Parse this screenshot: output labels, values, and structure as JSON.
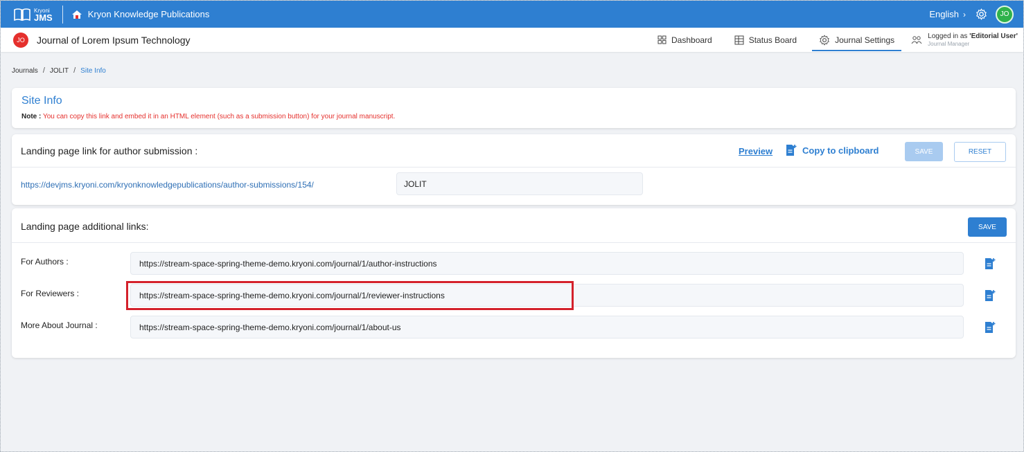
{
  "topbar": {
    "logo_small": "Kryoni",
    "logo_big": "JMS",
    "org_name": "Kryon Knowledge Publications",
    "language": "English",
    "user_initials": "JO",
    "colors": {
      "bar": "#2e7fd1",
      "user_badge": "#2fb24b"
    }
  },
  "subheader": {
    "journal_initials": "JO",
    "journal_title": "Journal of Lorem Ipsum Technology",
    "nav": {
      "dashboard": "Dashboard",
      "status_board": "Status Board",
      "journal_settings": "Journal Settings"
    },
    "logged_prefix": "Logged in as ",
    "logged_user": "'Editorial User'",
    "logged_role": "Journal Manager"
  },
  "breadcrumb": {
    "items": [
      "Journals",
      "JOLIT",
      "Site Info"
    ],
    "separator": "/"
  },
  "site_info": {
    "title": "Site Info",
    "note_label": "Note :",
    "note_text": "You can copy this link and embed it in an HTML element (such as a submission button) for your journal manuscript."
  },
  "landing_link": {
    "label": "Landing page link for author submission :",
    "preview": "Preview",
    "copy": "Copy to clipboard",
    "save": "SAVE",
    "reset": "RESET",
    "url_prefix": "https://devjms.kryoni.com/kryonknowledgepublications/author-submissions/154/",
    "slug": "JOLIT"
  },
  "additional_links": {
    "label": "Landing page additional links:",
    "save": "SAVE",
    "rows": [
      {
        "label": "For Authors :",
        "value": "https://stream-space-spring-theme-demo.kryoni.com/journal/1/author-instructions"
      },
      {
        "label": "For Reviewers :",
        "value": "https://stream-space-spring-theme-demo.kryoni.com/journal/1/reviewer-instructions"
      },
      {
        "label": "More About Journal :",
        "value": "https://stream-space-spring-theme-demo.kryoni.com/journal/1/about-us"
      }
    ]
  },
  "icons": {
    "logo": "book-icon",
    "org": "home-icon",
    "settings": "gear-icon",
    "dashboard": "grid-icon",
    "status_board": "board-icon",
    "journal_settings": "settings-icon",
    "user": "users-icon",
    "copy": "copy-doc-icon"
  },
  "annotation": {
    "highlight_color": "#d4212b",
    "highlighted_row": "For Reviewers :"
  }
}
